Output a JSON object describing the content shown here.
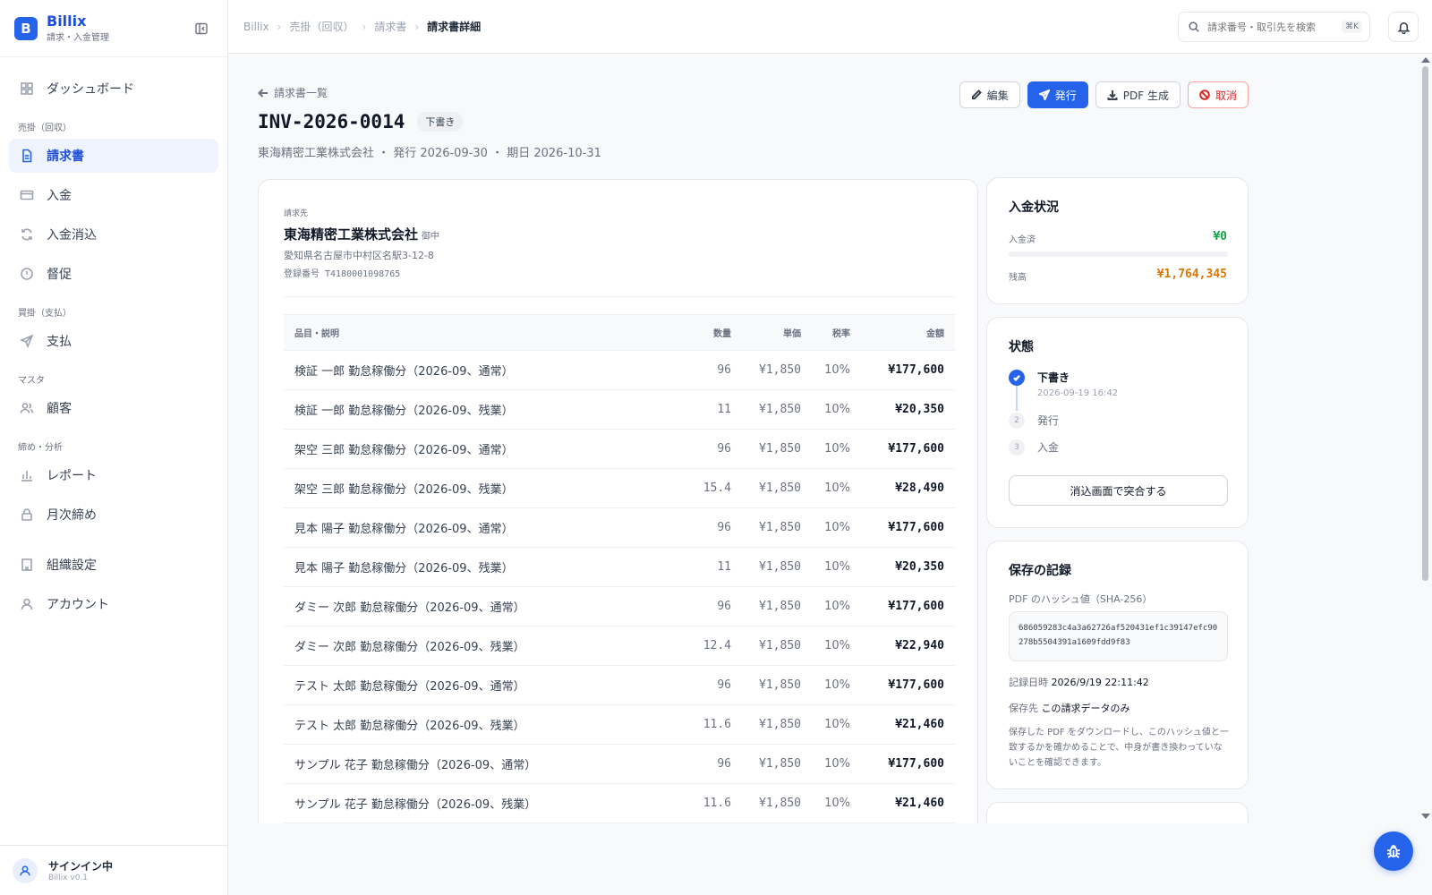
{
  "colors": {
    "accent": "#2563eb",
    "paid_green": "#16a34a",
    "remaining_orange": "#d97706",
    "danger": "#dc2626"
  },
  "sidebar": {
    "brand_initial": "B",
    "brand_name": "Billix",
    "brand_sub": "請求・入金管理",
    "dashboard": "ダッシュボード",
    "section_ar": "売掛（回収）",
    "invoices": "請求書",
    "payments": "入金",
    "reconciliation": "入金消込",
    "dunning": "督促",
    "section_ap": "買掛（支払）",
    "payouts": "支払",
    "section_master": "マスタ",
    "customers": "顧客",
    "section_close": "締め・分析",
    "reports": "レポート",
    "monthly_close": "月次締め",
    "org_settings": "組織設定",
    "account": "アカウント",
    "user_name": "サインイン中",
    "version": "Billix v0.1"
  },
  "header": {
    "breadcrumb": [
      "Billix",
      "売掛（回収）",
      "請求書",
      "請求書詳細"
    ],
    "search_placeholder": "請求番号・取引先を検索",
    "search_shortcut": "⌘K"
  },
  "page": {
    "back_label": "請求書一覧",
    "invoice_number": "INV-2026-0014",
    "status_badge": "下書き",
    "meta": "東海精密工業株式会社 ・ 発行 2026-09-30 ・ 期日 2026-10-31",
    "actions": {
      "edit": "編集",
      "issue": "発行",
      "pdf": "PDF 生成",
      "cancel": "取消"
    }
  },
  "invoice": {
    "bill_to_label": "請求先",
    "customer_name": "東海精密工業株式会社",
    "honorific": "御中",
    "address": "愛知県名古屋市中村区名駅3-12-8",
    "registration": "登録番号 T4180001098765",
    "columns": {
      "desc": "品目・説明",
      "qty": "数量",
      "unit_price": "単価",
      "tax": "税率",
      "amount": "金額"
    },
    "lines": [
      {
        "desc": "検証 一郎 勤怠稼働分（2026-09、通常）",
        "qty": "96",
        "unit_price": "¥1,850",
        "tax": "10%",
        "amount": "¥177,600"
      },
      {
        "desc": "検証 一郎 勤怠稼働分（2026-09、残業）",
        "qty": "11",
        "unit_price": "¥1,850",
        "tax": "10%",
        "amount": "¥20,350"
      },
      {
        "desc": "架空 三郎 勤怠稼働分（2026-09、通常）",
        "qty": "96",
        "unit_price": "¥1,850",
        "tax": "10%",
        "amount": "¥177,600"
      },
      {
        "desc": "架空 三郎 勤怠稼働分（2026-09、残業）",
        "qty": "15.4",
        "unit_price": "¥1,850",
        "tax": "10%",
        "amount": "¥28,490"
      },
      {
        "desc": "見本 陽子 勤怠稼働分（2026-09、通常）",
        "qty": "96",
        "unit_price": "¥1,850",
        "tax": "10%",
        "amount": "¥177,600"
      },
      {
        "desc": "見本 陽子 勤怠稼働分（2026-09、残業）",
        "qty": "11",
        "unit_price": "¥1,850",
        "tax": "10%",
        "amount": "¥20,350"
      },
      {
        "desc": "ダミー 次郎 勤怠稼働分（2026-09、通常）",
        "qty": "96",
        "unit_price": "¥1,850",
        "tax": "10%",
        "amount": "¥177,600"
      },
      {
        "desc": "ダミー 次郎 勤怠稼働分（2026-09、残業）",
        "qty": "12.4",
        "unit_price": "¥1,850",
        "tax": "10%",
        "amount": "¥22,940"
      },
      {
        "desc": "テスト 太郎 勤怠稼働分（2026-09、通常）",
        "qty": "96",
        "unit_price": "¥1,850",
        "tax": "10%",
        "amount": "¥177,600"
      },
      {
        "desc": "テスト 太郎 勤怠稼働分（2026-09、残業）",
        "qty": "11.6",
        "unit_price": "¥1,850",
        "tax": "10%",
        "amount": "¥21,460"
      },
      {
        "desc": "サンプル 花子 勤怠稼働分（2026-09、通常）",
        "qty": "96",
        "unit_price": "¥1,850",
        "tax": "10%",
        "amount": "¥177,600"
      },
      {
        "desc": "サンプル 花子 勤怠稼働分（2026-09、残業）",
        "qty": "11.6",
        "unit_price": "¥1,850",
        "tax": "10%",
        "amount": "¥21,460"
      }
    ]
  },
  "payment_status": {
    "title": "入金状況",
    "paid_label": "入金済",
    "paid_value": "¥0",
    "paid_fraction": 0,
    "remaining_label": "残高",
    "remaining_value": "¥1,764,345"
  },
  "state": {
    "title": "状態",
    "steps": [
      {
        "num": "1",
        "label": "下書き",
        "time": "2026-09-19 16:42"
      },
      {
        "num": "2",
        "label": "発行"
      },
      {
        "num": "3",
        "label": "入金"
      }
    ],
    "reconcile_button": "消込画面で突合する"
  },
  "record": {
    "title": "保存の記録",
    "hash_label": "PDF のハッシュ値（SHA-256）",
    "hash_value": "686059283c4a3a62726af520431ef1c39147efc90278b5504391a1609fdd9f83",
    "recorded_label": "記録日時",
    "recorded_value": "2026/9/19 22:11:42",
    "storage_label": "保存先",
    "storage_value": "この請求データのみ",
    "note": "保存した PDF をダウンロードし、このハッシュ値と一致するかを確かめることで、中身が書き換わっていないことを確認できます。"
  }
}
